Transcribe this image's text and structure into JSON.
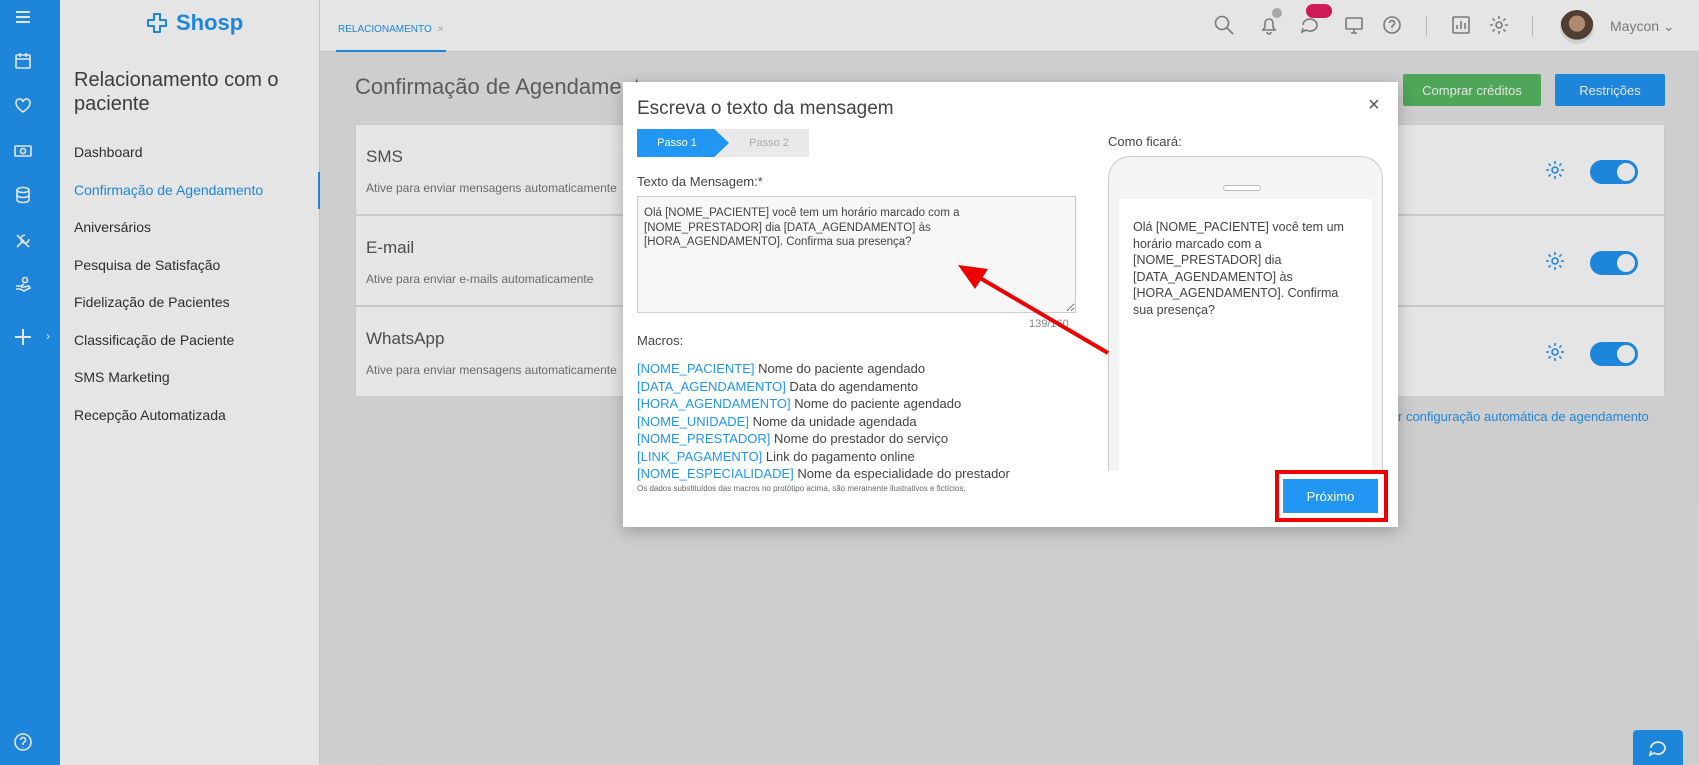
{
  "app": {
    "logo_text": "Shosp"
  },
  "rail": {
    "icons": [
      "menu-icon",
      "calendar-icon",
      "heart-icon",
      "cash-icon",
      "database-icon",
      "tools-icon",
      "hand-icon",
      "plus-icon",
      "help-icon"
    ]
  },
  "nav": {
    "title": "Relacionamento com o paciente",
    "items": [
      {
        "label": "Dashboard",
        "active": false
      },
      {
        "label": "Confirmação de Agendamento",
        "active": true
      },
      {
        "label": "Aniversários",
        "active": false
      },
      {
        "label": "Pesquisa de Satisfação",
        "active": false
      },
      {
        "label": "Fidelização de Pacientes",
        "active": false
      },
      {
        "label": "Classificação de Paciente",
        "active": false
      },
      {
        "label": "SMS Marketing",
        "active": false
      },
      {
        "label": "Recepção Automatizada",
        "active": false
      }
    ]
  },
  "topbar": {
    "tab_label": "RELACIONAMENTO",
    "tab_close": "×",
    "icons": [
      "search-icon",
      "bell-icon",
      "chat-icon",
      "monitor-icon",
      "help-icon",
      "report-icon",
      "settings-icon"
    ],
    "username": "Maycon",
    "user_chevron": "⌄"
  },
  "main": {
    "title": "Confirmação de Agendamento",
    "buy_credits": "Comprar créditos",
    "restrictions": "Restrições",
    "cards": [
      {
        "title": "SMS",
        "desc": "Ative para enviar mensagens automaticamente",
        "enabled": true
      },
      {
        "title": "E-mail",
        "desc": "Ative para enviar e-mails automaticamente",
        "enabled": true
      },
      {
        "title": "WhatsApp",
        "desc": "Ative para enviar mensagens automaticamente",
        "enabled": true
      }
    ],
    "auto_link": "r configuração automática de agendamento"
  },
  "modal": {
    "title": "Escreva o texto da mensagem",
    "close": "×",
    "step1": "Passo 1",
    "step2": "Passo 2",
    "message_label": "Texto da Mensagem:*",
    "message_value": "Olá [NOME_PACIENTE] você tem um horário marcado com a [NOME_PRESTADOR] dia [DATA_AGENDAMENTO] às [HORA_AGENDAMENTO]. Confirma sua presença?",
    "counter": "139/160",
    "macros_label": "Macros:",
    "macros": [
      {
        "tag": "[NOME_PACIENTE]",
        "desc": " Nome do paciente agendado"
      },
      {
        "tag": "[DATA_AGENDAMENTO]",
        "desc": " Data do agendamento"
      },
      {
        "tag": "[HORA_AGENDAMENTO]",
        "desc": " Nome do paciente agendado"
      },
      {
        "tag": "[NOME_UNIDADE]",
        "desc": " Nome da unidade agendada"
      },
      {
        "tag": "[NOME_PRESTADOR]",
        "desc": " Nome do prestador do serviço"
      },
      {
        "tag": "[LINK_PAGAMENTO]",
        "desc": " Link do pagamento online"
      },
      {
        "tag": "[NOME_ESPECIALIDADE]",
        "desc": " Nome da especialidade do prestador"
      }
    ],
    "disclaimer": "Os dados substituídos das macros no protótipo acima, são meramente ilustrativos e fictícios.",
    "preview_label": "Como ficará:",
    "preview_text": "Olá [NOME_PACIENTE] você tem um horário marcado com a [NOME_PRESTADOR] dia [DATA_AGENDAMENTO] às [HORA_AGENDAMENTO]. Confirma sua presença?",
    "next_button": "Próximo"
  },
  "colors": {
    "accent": "#2196f3",
    "green": "#59b863",
    "highlight": "#e00000",
    "badge": "#e91e63"
  }
}
